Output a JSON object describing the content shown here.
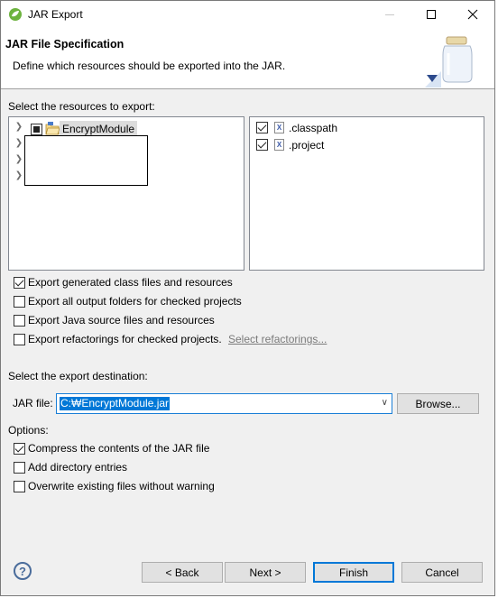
{
  "window": {
    "title": "JAR Export"
  },
  "header": {
    "title": "JAR File Specification",
    "description": "Define which resources should be exported into the JAR."
  },
  "resources": {
    "label": "Select the resources to export:",
    "tree": [
      {
        "label": "EncryptModule",
        "state": "partial"
      }
    ],
    "files": [
      {
        "label": ".classpath",
        "checked": true
      },
      {
        "label": ".project",
        "checked": true
      }
    ]
  },
  "export_options": [
    {
      "label": "Export generated class files and resources",
      "checked": true
    },
    {
      "label": "Export all output folders for checked projects",
      "checked": false
    },
    {
      "label": "Export Java source files and resources",
      "checked": false
    },
    {
      "label": "Export refactorings for checked projects.",
      "checked": false
    }
  ],
  "select_refactorings_link": "Select refactorings...",
  "destination": {
    "label": "Select the export destination:",
    "jar_file_label": "JAR file:",
    "jar_file_value": "C:₩EncryptModule.jar",
    "browse_label": "Browse..."
  },
  "options": {
    "label": "Options:",
    "items": [
      {
        "label": "Compress the contents of the JAR file",
        "checked": true
      },
      {
        "label": "Add directory entries",
        "checked": false
      },
      {
        "label": "Overwrite existing files without warning",
        "checked": false
      }
    ]
  },
  "footer": {
    "back_label": "< Back",
    "next_label": "Next >",
    "finish_label": "Finish",
    "cancel_label": "Cancel"
  },
  "colors": {
    "accent": "#0078d7",
    "dialog_bg": "#f0f0f0"
  }
}
